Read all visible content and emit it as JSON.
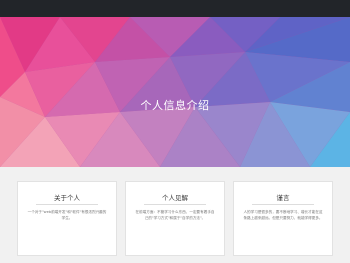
{
  "hero": {
    "title": "个人信息介绍"
  },
  "cards": [
    {
      "title": "关于个人",
      "body": "一个对于\"web前端开发\"和\"软件\"有很浓烈兴趣的学生。"
    },
    {
      "title": "个人见解",
      "body": "在前端方面：不管学习什么东西，一定要有着手自己的\"学习方式\"和属于\"自学的方法\"。"
    },
    {
      "title": "谨言",
      "body": "人的学习是很多的，要不断地学习、增长才能在这条路上越来越远。但是只要努力，就能学得更多。"
    }
  ],
  "colors": {
    "topbar": "#222529",
    "background": "#f1f1f1",
    "card": "#ffffff"
  }
}
